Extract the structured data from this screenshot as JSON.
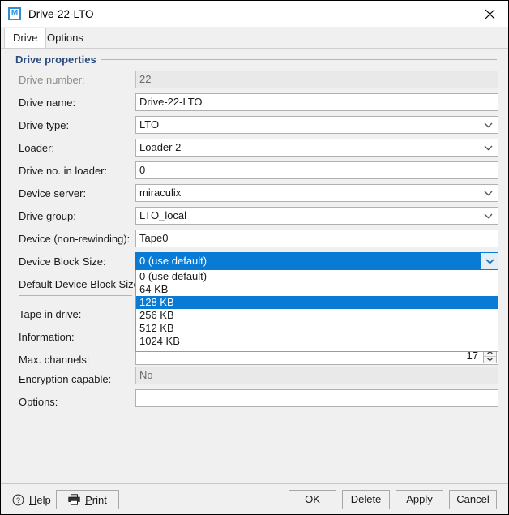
{
  "window": {
    "title": "Drive-22-LTO",
    "app_icon": "M",
    "close_icon": "close-icon"
  },
  "tabs": [
    {
      "label": "Drive",
      "active": true
    },
    {
      "label": "Options",
      "active": false
    }
  ],
  "group": {
    "title": "Drive properties"
  },
  "form": {
    "rows": [
      {
        "label": "Drive number:",
        "value": "22",
        "type": "text",
        "disabled": true
      },
      {
        "label": "Drive name:",
        "value": "Drive-22-LTO",
        "type": "text",
        "disabled": false
      },
      {
        "label": "Drive type:",
        "value": "LTO",
        "type": "combo",
        "disabled": false
      },
      {
        "label": "Loader:",
        "value": "Loader 2",
        "type": "combo",
        "disabled": false
      },
      {
        "label": "Drive no. in loader:",
        "value": "0",
        "type": "text",
        "disabled": false
      },
      {
        "label": "Device server:",
        "value": "miraculix",
        "type": "combo",
        "disabled": false
      },
      {
        "label": "Drive group:",
        "value": "LTO_local",
        "type": "combo",
        "disabled": false
      },
      {
        "label": "Device (non-rewinding):",
        "value": "Tape0",
        "type": "text",
        "disabled": false
      }
    ],
    "device_block_size": {
      "label": "Device Block Size:",
      "selected_value": "0 (use default)",
      "open": true,
      "options": [
        "0 (use default)",
        "64 KB",
        "128 KB",
        "256 KB",
        "512 KB",
        "1024 KB"
      ],
      "highlighted_option": "128 KB"
    },
    "default_device_block_size": {
      "label": "Default Device Block Size:",
      "value": ""
    },
    "tape_in_drive": {
      "label": "Tape in drive:",
      "value": ""
    },
    "information": {
      "label": "Information:",
      "value": ""
    },
    "max_channels": {
      "label": "Max. channels:",
      "value": "17"
    },
    "encryption_capable": {
      "label": "Encryption capable:",
      "value": "No",
      "disabled": true
    },
    "options_field": {
      "label": "Options:",
      "value": ""
    }
  },
  "footer": {
    "help": {
      "label_pre": "H",
      "label_post": "elp",
      "icon": "help-circle-icon"
    },
    "print": {
      "label_pre": "P",
      "label_post": "rint",
      "icon": "printer-icon"
    },
    "ok": {
      "pre": "",
      "accel": "O",
      "post": "K"
    },
    "delete": {
      "pre": "De",
      "accel": "l",
      "post": "ete"
    },
    "apply": {
      "pre": "",
      "accel": "A",
      "post": "pply"
    },
    "cancel": {
      "pre": "",
      "accel": "C",
      "post": "ancel"
    }
  },
  "colors": {
    "selection_blue": "#0a7bd4",
    "group_title": "#2a4b7c",
    "dialog_bg": "#f0f0f0",
    "accent_icon": "#2b8fd6"
  }
}
